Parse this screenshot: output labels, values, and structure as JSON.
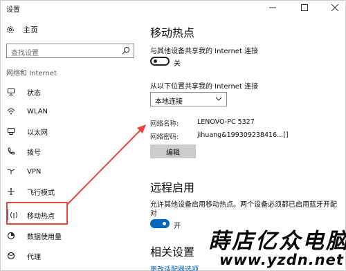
{
  "window": {
    "title": "设置",
    "controls": [
      "minimize",
      "maximize",
      "close"
    ]
  },
  "sidebar": {
    "home_label": "主页",
    "search_placeholder": "查找设置",
    "section_title": "网络和 Internet",
    "items": [
      {
        "label": "状态",
        "icon": "status-icon"
      },
      {
        "label": "WLAN",
        "icon": "wifi-icon"
      },
      {
        "label": "以太网",
        "icon": "ethernet-icon"
      },
      {
        "label": "拨号",
        "icon": "dialup-icon"
      },
      {
        "label": "VPN",
        "icon": "vpn-icon"
      },
      {
        "label": "飞行模式",
        "icon": "airplane-icon"
      },
      {
        "label": "移动热点",
        "icon": "hotspot-icon",
        "active": true
      },
      {
        "label": "数据使用量",
        "icon": "data-usage-icon"
      },
      {
        "label": "代理",
        "icon": "proxy-icon"
      }
    ]
  },
  "main": {
    "hotspot_title": "移动热点",
    "share_desc": "与其他设备共享我的 Internet 连接",
    "share_toggle": {
      "on": false,
      "state_label": "关"
    },
    "share_from_label": "从以下位置共享我的 Internet 连接",
    "share_from_value": "本地连接",
    "network_name_label": "网络名称:",
    "network_name_value": "LENOVO-PC 5327",
    "network_password_label": "网络密码:",
    "network_password_value": "jihuang&199309238416...[]",
    "edit_button": "编辑",
    "remote_title": "远程启用",
    "remote_desc_line1": "允许其他设备启用移动热点。两个设备必须都已启用蓝牙开配",
    "remote_desc_line2": "对",
    "remote_toggle": {
      "on": true,
      "state_label": "开"
    },
    "related_title": "相关设置",
    "related_link": "更改适配器选项"
  },
  "annotation": {
    "highlight_color": "#e8453c",
    "accent_color": "#0067c0"
  },
  "watermark": {
    "line1": "蒔店亿众电脑",
    "line2": "www.yzdn.net"
  }
}
